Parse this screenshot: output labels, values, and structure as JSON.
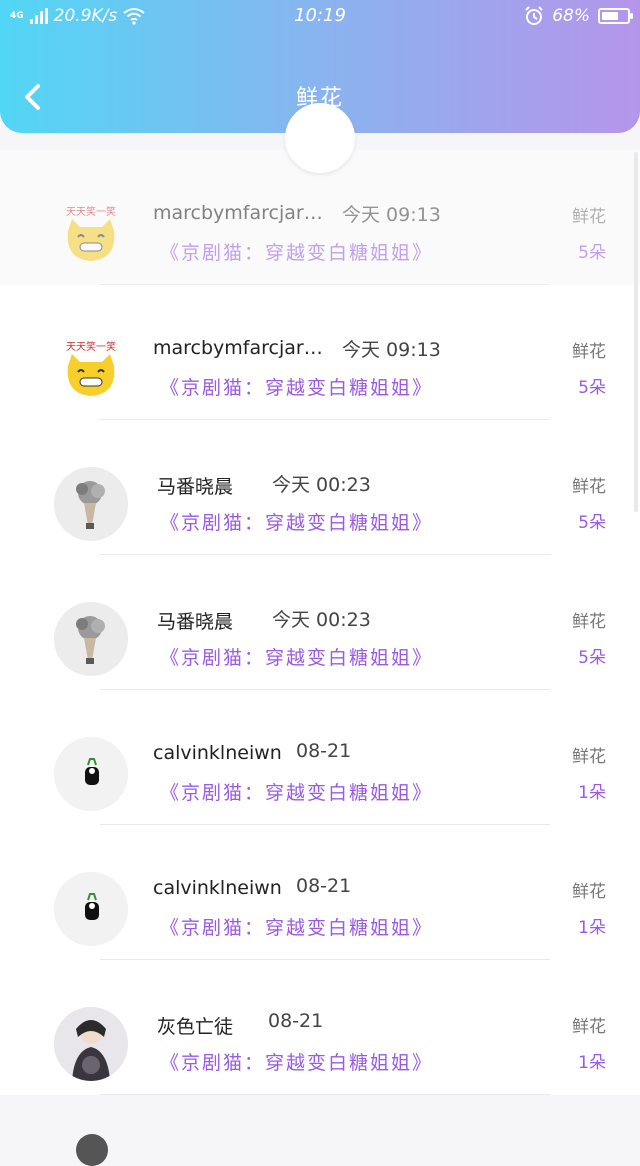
{
  "status_bar": {
    "network": "4G",
    "speed": "20.9K/s",
    "time": "10:19",
    "battery_percent": "68%",
    "battery_level": 0.68,
    "icons": [
      "signal-icon",
      "wifi-icon",
      "alarm-icon",
      "battery-icon"
    ]
  },
  "header": {
    "title": "鲜花",
    "back_icon": "chevron-left-icon",
    "gradient_start": "#52d6f5",
    "gradient_end": "#b595ea"
  },
  "accent_color": "#9a5be0",
  "items": [
    {
      "name": "marcbymfarcjar…",
      "time": "今天 09:13",
      "work": "《京剧猫：穿越变白糖姐姐》",
      "gift": "鲜花",
      "count": "5朵",
      "avatar": "cat-emoji-avatar"
    },
    {
      "name": "marcbymfarcjar…",
      "time": "今天 09:13",
      "work": "《京剧猫：穿越变白糖姐姐》",
      "gift": "鲜花",
      "count": "5朵",
      "avatar": "cat-emoji-avatar"
    },
    {
      "name": "马番晓晨",
      "time": "今天 00:23",
      "work": "《京剧猫：穿越变白糖姐姐》",
      "gift": "鲜花",
      "count": "5朵",
      "avatar": "bouquet-avatar"
    },
    {
      "name": "马番晓晨",
      "time": "今天 00:23",
      "work": "《京剧猫：穿越变白糖姐姐》",
      "gift": "鲜花",
      "count": "5朵",
      "avatar": "bouquet-avatar"
    },
    {
      "name": "calvinklneiwn",
      "time": "08-21",
      "work": "《京剧猫：穿越变白糖姐姐》",
      "gift": "鲜花",
      "count": "1朵",
      "avatar": "figure-avatar"
    },
    {
      "name": "calvinklneiwn",
      "time": "08-21",
      "work": "《京剧猫：穿越变白糖姐姐》",
      "gift": "鲜花",
      "count": "1朵",
      "avatar": "figure-avatar"
    },
    {
      "name": "灰色亡徒",
      "time": "08-21",
      "work": "《京剧猫：穿越变白糖姐姐》",
      "gift": "鲜花",
      "count": "1朵",
      "avatar": "anime-avatar"
    }
  ]
}
